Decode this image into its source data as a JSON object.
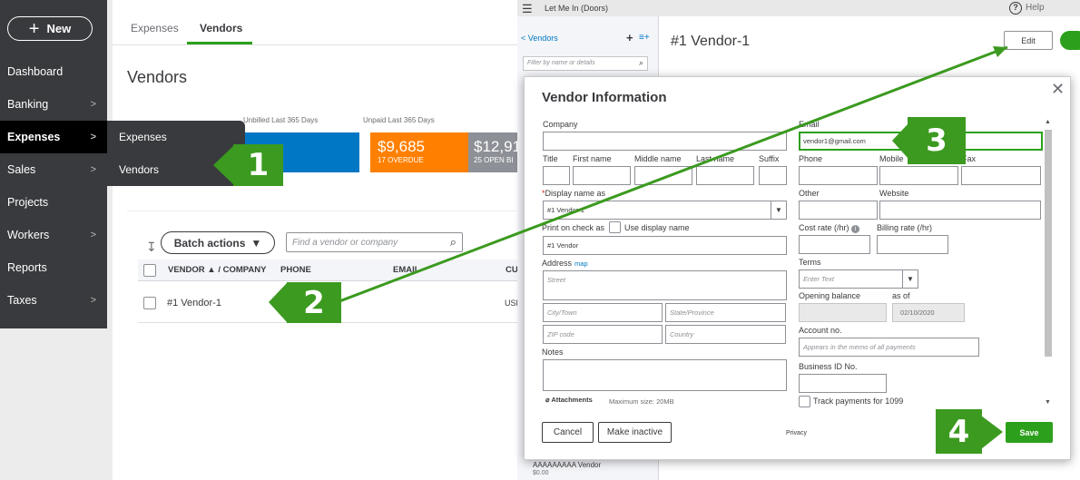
{
  "sidebar": {
    "new_label": "New",
    "items": [
      {
        "label": "Dashboard",
        "chevron": false
      },
      {
        "label": "Banking",
        "chevron": true
      },
      {
        "label": "Expenses",
        "chevron": true
      },
      {
        "label": "Sales",
        "chevron": true
      },
      {
        "label": "Projects",
        "chevron": false
      },
      {
        "label": "Workers",
        "chevron": true
      },
      {
        "label": "Reports",
        "chevron": false
      },
      {
        "label": "Taxes",
        "chevron": true
      }
    ]
  },
  "submenu": {
    "items": [
      "Expenses",
      "Vendors"
    ]
  },
  "tabs": [
    "Expenses",
    "Vendors"
  ],
  "page_title": "Vendors",
  "money_bar": {
    "unbilled_label": "Unbilled Last 365 Days",
    "unpaid_label": "Unpaid Last 365 Days",
    "overdue_amount": "$9,685",
    "overdue_text": "17 OVERDUE",
    "open_amount": "$12,91",
    "open_text": "25 OPEN BI"
  },
  "list": {
    "batch_actions": "Batch actions",
    "search_placeholder": "Find a vendor or company",
    "columns": [
      "VENDOR ▲ / COMPANY",
      "PHONE",
      "EMAIL",
      "CU"
    ],
    "rows": [
      {
        "vendor": "#1 Vendor-1",
        "currency": "USD"
      }
    ]
  },
  "right_page": {
    "top_title": "Let Me In (Doors)",
    "help": "Help",
    "back_link": "< Vendors",
    "filter_placeholder": "Filter by name or details",
    "vendor_heading": "#1 Vendor-1",
    "edit_label": "Edit",
    "footer_vendor": "AAAAAAAAA Vendor",
    "footer_amount": "$0.00"
  },
  "modal": {
    "title": "Vendor Information",
    "labels": {
      "company": "Company",
      "email": "Email",
      "title": "Title",
      "first": "First name",
      "middle": "Middle name",
      "last": "Last name",
      "suffix": "Suffix",
      "phone": "Phone",
      "mobile": "Mobile",
      "fax": "Fax",
      "display_name": "Display name as",
      "other": "Other",
      "website": "Website",
      "print_on_check": "Print on check as",
      "use_display": "Use display name",
      "cost_rate": "Cost rate (/hr)",
      "billing_rate": "Billing rate (/hr)",
      "address": "Address",
      "map": "map",
      "terms": "Terms",
      "opening_balance": "Opening balance",
      "as_of": "as of",
      "notes": "Notes",
      "account_no": "Account no.",
      "business_id": "Business ID No.",
      "track_1099": "Track payments for 1099",
      "attachments": "Attachments",
      "max_size": "Maximum size: 20MB"
    },
    "values": {
      "email": "vendor1@gmail.com",
      "display_name": "#1 Vendor-1",
      "print_on_check": "#1 Vendor",
      "as_of_date": "02/10/2020"
    },
    "placeholders": {
      "street": "Street",
      "city": "City/Town",
      "state": "State/Province",
      "zip": "ZIP code",
      "country": "Country",
      "terms": "Enter Text",
      "account_no": "Appears in the memo of all payments"
    },
    "buttons": {
      "cancel": "Cancel",
      "make_inactive": "Make inactive",
      "save": "Save"
    },
    "privacy": "Privacy"
  },
  "callouts": [
    "1",
    "2",
    "3",
    "4"
  ],
  "colors": {
    "qb_green": "#2ca01c",
    "callout_green": "#3b9a1f",
    "sidebar": "#393a3d",
    "blue": "#0077c5",
    "orange": "#ff8000"
  }
}
